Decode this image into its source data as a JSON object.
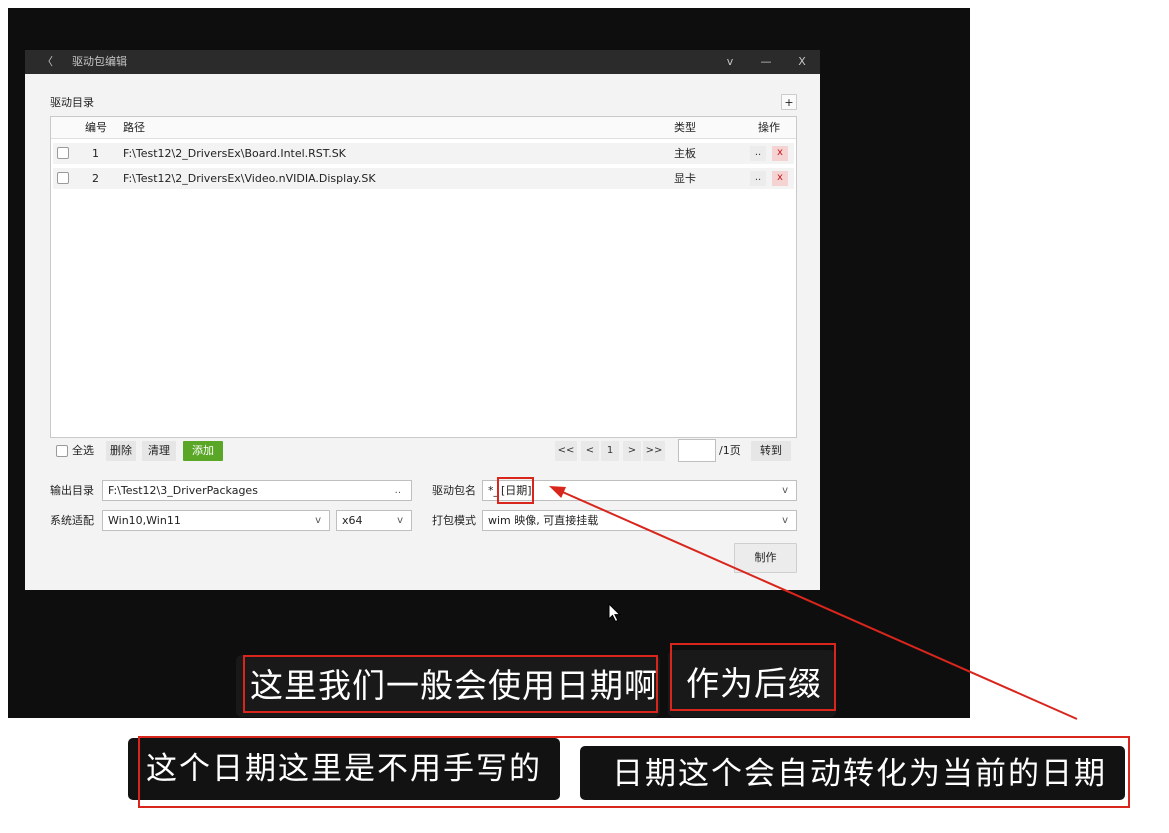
{
  "window": {
    "back_glyph": "〈",
    "title": "驱动包编辑",
    "controls": {
      "menu": "v",
      "minimize": "—",
      "close": "X"
    }
  },
  "driver_dir": {
    "label": "驱动目录",
    "add_label": "+",
    "columns": {
      "index": "编号",
      "path": "路径",
      "type": "类型",
      "ops": "操作"
    },
    "rows": [
      {
        "index": "1",
        "path": "F:\\Test12\\2_DriversEx\\Board.Intel.RST.SK",
        "type": "主板",
        "browse": "..",
        "delete": "x"
      },
      {
        "index": "2",
        "path": "F:\\Test12\\2_DriversEx\\Video.nVIDIA.Display.SK",
        "type": "显卡",
        "browse": "..",
        "delete": "x"
      }
    ]
  },
  "toolbar": {
    "select_all": "全选",
    "delete": "删除",
    "clear": "清理",
    "add": "添加"
  },
  "pagination": {
    "first": "<<",
    "prev": "<",
    "current": "1",
    "next": ">",
    "last": ">>",
    "total": "/1页",
    "goto": "转到"
  },
  "form": {
    "output_dir": {
      "label": "输出目录",
      "value": "F:\\Test12\\3_DriverPackages",
      "browse": ".."
    },
    "package_name": {
      "label": "驱动包名",
      "prefix": "*_",
      "token": "[日期]",
      "arrow": "v"
    },
    "os": {
      "label": "系统适配",
      "value": "Win10,Win11",
      "arrow": "v"
    },
    "arch": {
      "value": "x64",
      "arrow": "v"
    },
    "pack_mode": {
      "label": "打包模式",
      "value": "wim 映像, 可直接挂载",
      "arrow": "v"
    },
    "make": "制作"
  },
  "subtitles": [
    "这里我们一般会使用日期啊",
    "作为后缀",
    "这个日期这里是不用手写的",
    "日期这个会自动转化为当前的日期"
  ],
  "icons": {
    "cursor": "mouse-pointer-icon",
    "annotation": "red-arrow-icon"
  },
  "colors": {
    "green": "#5aa626",
    "red": "#d8261d",
    "del-bg": "#f6d3d3"
  }
}
